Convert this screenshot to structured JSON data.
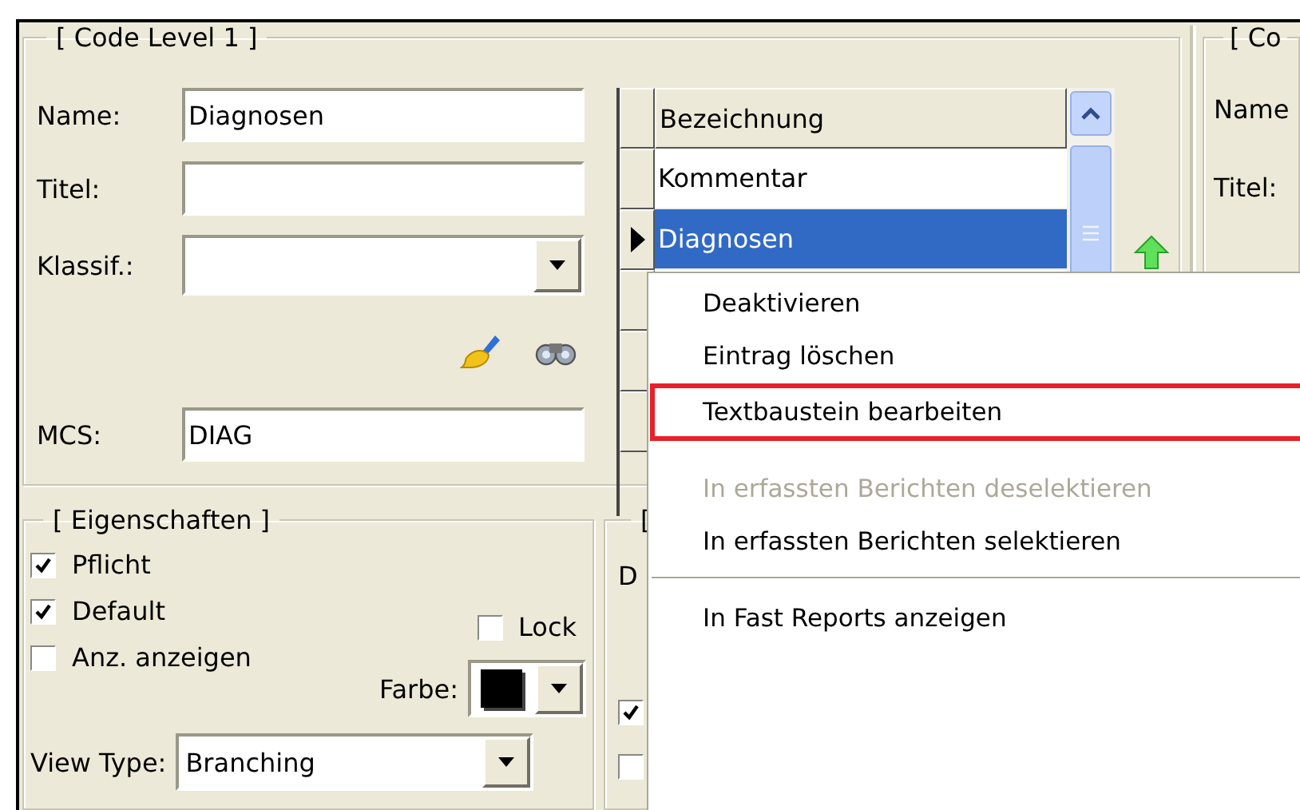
{
  "main_panel": {
    "legend": "[ Code Level 1 ]",
    "fields": [
      {
        "kind": "text",
        "label": "Name:",
        "value": "Diagnosen"
      },
      {
        "kind": "text",
        "label": "Titel:"
      },
      {
        "kind": "combo",
        "label": "Klassif.:"
      },
      {
        "kind": "icons"
      },
      {
        "kind": "text",
        "label": "MCS:",
        "value": "DIAG"
      }
    ],
    "grid": {
      "column": "Bezeichnung",
      "rows": [
        {
          "kind": "entry",
          "text": "Kommentar",
          "selected": false
        },
        {
          "kind": "entry",
          "text": "Diagnosen",
          "selected": true
        },
        {
          "kind": "empty",
          "selected": false
        },
        {
          "kind": "empty",
          "selected": false
        },
        {
          "kind": "empty",
          "selected": false
        }
      ]
    }
  },
  "properties": {
    "legend": "[ Eigenschaften ]",
    "checkboxes": [
      {
        "label": "Pflicht",
        "checked": true
      },
      {
        "label": "Default",
        "checked": true
      },
      {
        "label": "Anz. anzeigen",
        "checked": false
      }
    ],
    "lock": {
      "label": "Lock",
      "checked": false
    },
    "color": {
      "label": "Farbe:",
      "color": "#000000"
    },
    "view_type": {
      "label": "View Type:",
      "value": "Branching"
    }
  },
  "second_group": {
    "legend": "[",
    "label": "D",
    "checkboxes": [
      {
        "checked": true
      },
      {
        "checked": false
      }
    ]
  },
  "right_panel": {
    "legend": "[ Co",
    "labels": [
      "Name",
      "Titel:"
    ]
  },
  "context_menu": {
    "items": [
      {
        "kind": "item",
        "label": "Deaktivieren",
        "disabled": false,
        "highlighted": false
      },
      {
        "kind": "item",
        "label": "Eintrag löschen",
        "disabled": false,
        "highlighted": false
      },
      {
        "kind": "item",
        "label": "Textbaustein bearbeiten",
        "disabled": false,
        "highlighted": true
      },
      {
        "kind": "item",
        "label": "In erfassten Berichten deselektieren",
        "disabled": true,
        "highlighted": false
      },
      {
        "kind": "item",
        "label": "In erfassten Berichten selektieren",
        "disabled": false,
        "highlighted": false
      },
      {
        "kind": "separator"
      },
      {
        "kind": "item",
        "label": "In Fast Reports anzeigen",
        "disabled": false,
        "highlighted": false
      }
    ]
  }
}
